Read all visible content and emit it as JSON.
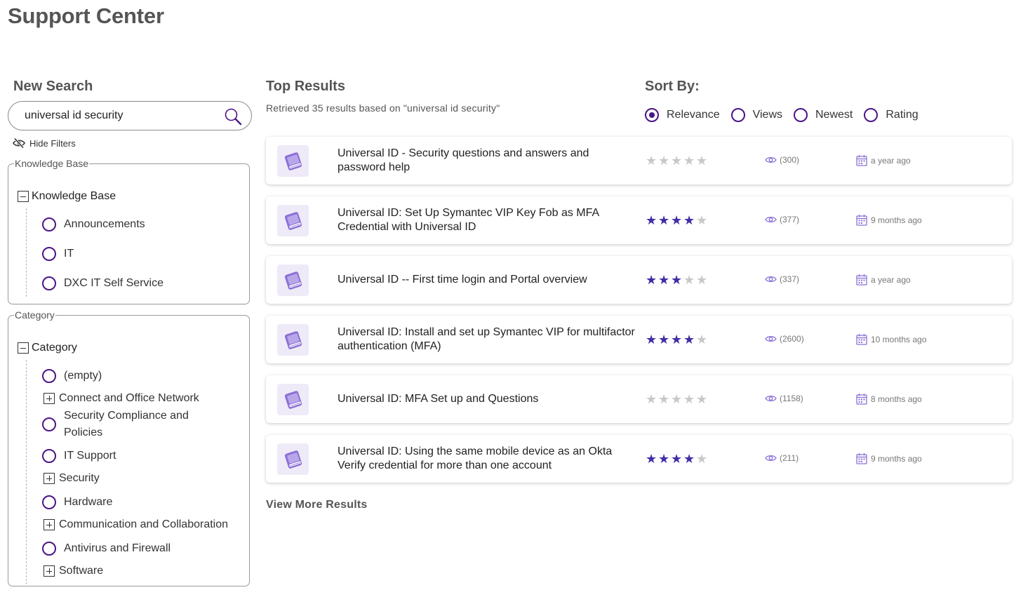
{
  "page_title": "Support Center",
  "search": {
    "heading": "New Search",
    "value": "universal id security",
    "hide_filters_label": "Hide Filters"
  },
  "knowledge_base_filter": {
    "legend": "Knowledge Base",
    "root_label": "Knowledge Base",
    "items": [
      {
        "label": "Announcements"
      },
      {
        "label": "IT"
      },
      {
        "label": "DXC IT Self Service"
      }
    ]
  },
  "category_filter": {
    "legend": "Category",
    "root_label": "Category",
    "items": [
      {
        "label": "(empty)",
        "kind": "radio"
      },
      {
        "label": "Connect and Office Network",
        "kind": "expand"
      },
      {
        "label": "Security Compliance and Policies",
        "kind": "radio"
      },
      {
        "label": "IT Support",
        "kind": "radio"
      },
      {
        "label": "Security",
        "kind": "expand"
      },
      {
        "label": "Hardware",
        "kind": "radio"
      },
      {
        "label": "Communication and Collaboration",
        "kind": "expand"
      },
      {
        "label": "Antivirus and Firewall",
        "kind": "radio"
      },
      {
        "label": "Software",
        "kind": "expand"
      }
    ]
  },
  "results": {
    "heading": "Top Results",
    "summary": "Retrieved 35 results based on \"universal id security\"",
    "items": [
      {
        "title": "Universal ID - Security questions and answers and password help",
        "rating": 0,
        "views": "(300)",
        "date": "a year ago"
      },
      {
        "title": "Universal ID: Set Up Symantec VIP Key Fob as MFA Credential with Universal ID",
        "rating": 4,
        "views": "(377)",
        "date": "9 months ago"
      },
      {
        "title": "Universal ID -- First time login and Portal overview",
        "rating": 3,
        "views": "(337)",
        "date": "a year ago"
      },
      {
        "title": "Universal ID: Install and set up Symantec VIP for multifactor authentication (MFA)",
        "rating": 4,
        "views": "(2600)",
        "date": "10 months ago"
      },
      {
        "title": "Universal ID: MFA Set up and Questions",
        "rating": 0,
        "views": "(1158)",
        "date": "8 months ago"
      },
      {
        "title": "Universal ID: Using the same mobile device as an Okta Verify credential for more than one account",
        "rating": 4,
        "views": "(211)",
        "date": "9 months ago"
      }
    ],
    "view_more_label": "View More Results"
  },
  "sort": {
    "heading": "Sort By:",
    "options": [
      "Relevance",
      "Views",
      "Newest",
      "Rating"
    ],
    "selected": "Relevance"
  },
  "colors": {
    "accent": "#4b1487",
    "star_filled": "#3f2ea7",
    "star_empty": "#c8c8c8",
    "icon_purple": "#8b70d6",
    "icon_bg": "#efeaf7"
  }
}
